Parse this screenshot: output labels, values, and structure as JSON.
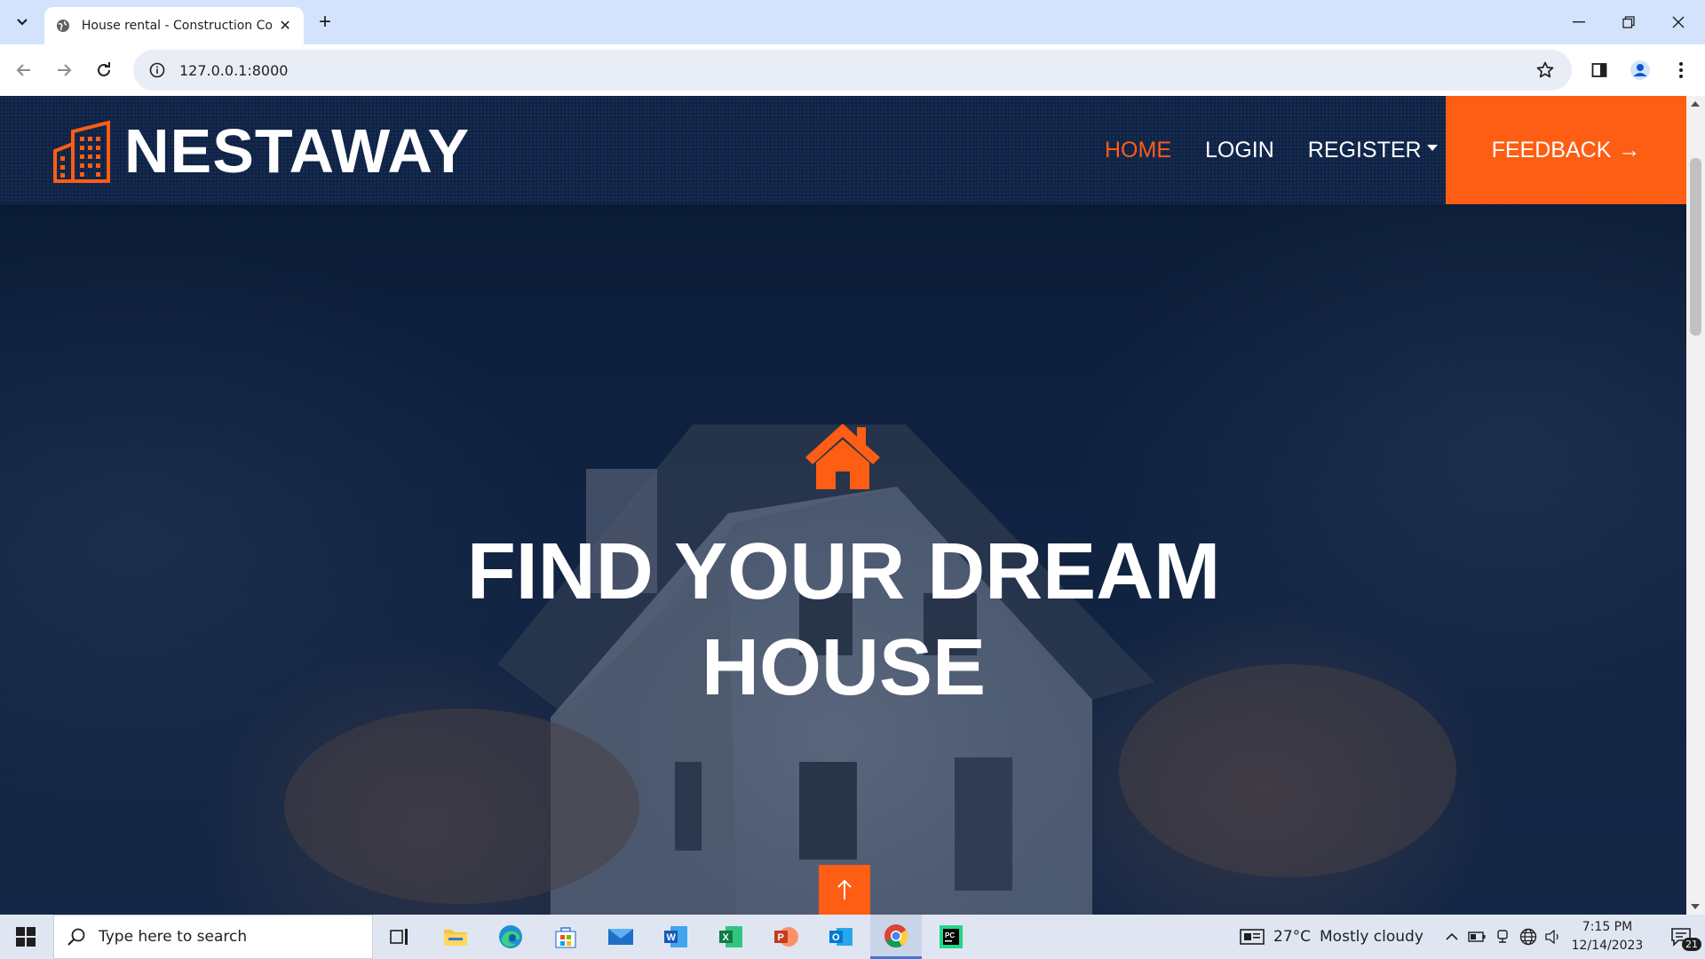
{
  "browser": {
    "tab_title": "House rental - Construction Co",
    "url": "127.0.0.1:8000"
  },
  "site": {
    "brand_name": "NESTAWAY",
    "nav": {
      "home": "HOME",
      "login": "LOGIN",
      "register": "REGISTER"
    },
    "feedback_label": "FEEDBACK",
    "feedback_arrow": "→",
    "hero_title_line1": "FIND YOUR DREAM",
    "hero_title_line2": "HOUSE",
    "accent_color": "#fe5d14",
    "header_color": "#0f2347"
  },
  "taskbar": {
    "search_placeholder": "Type here to search",
    "temperature": "27°C",
    "weather": "Mostly cloudy",
    "time": "7:15 PM",
    "date": "12/14/2023",
    "notification_count": "21"
  }
}
